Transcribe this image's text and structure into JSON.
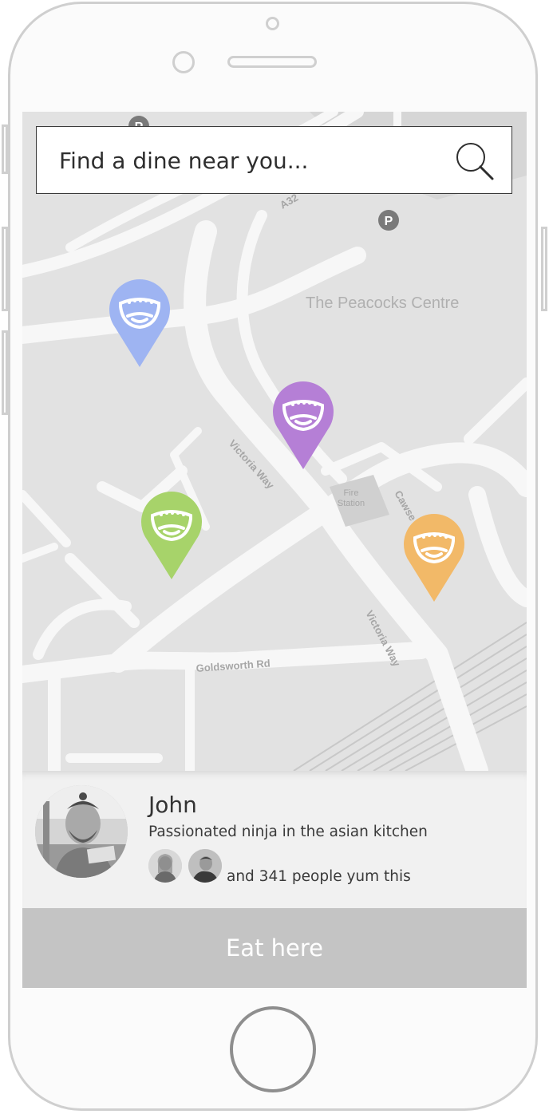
{
  "search": {
    "placeholder": "Find a dine near you..."
  },
  "map": {
    "labels": {
      "peacocks": "The Peacocks Centre",
      "victoria_way_1": "Victoria Way",
      "victoria_way_2": "Victoria Way",
      "fire_station_line1": "Fire",
      "fire_station_line2": "Station",
      "cawsey": "Cawse",
      "goldsworth": "Goldsworth Rd",
      "a32": "A32",
      "parking": "P"
    },
    "pins": [
      {
        "name": "blue",
        "color": "#9eb4f2"
      },
      {
        "name": "purple",
        "color": "#b57fd6"
      },
      {
        "name": "green",
        "color": "#a7d36a"
      },
      {
        "name": "orange",
        "color": "#f2b968"
      }
    ]
  },
  "card": {
    "name": "John",
    "tagline": "Passionated ninja in the asian kitchen",
    "yum_text": "and 341 people yum this"
  },
  "action": {
    "eat_label": "Eat here"
  }
}
